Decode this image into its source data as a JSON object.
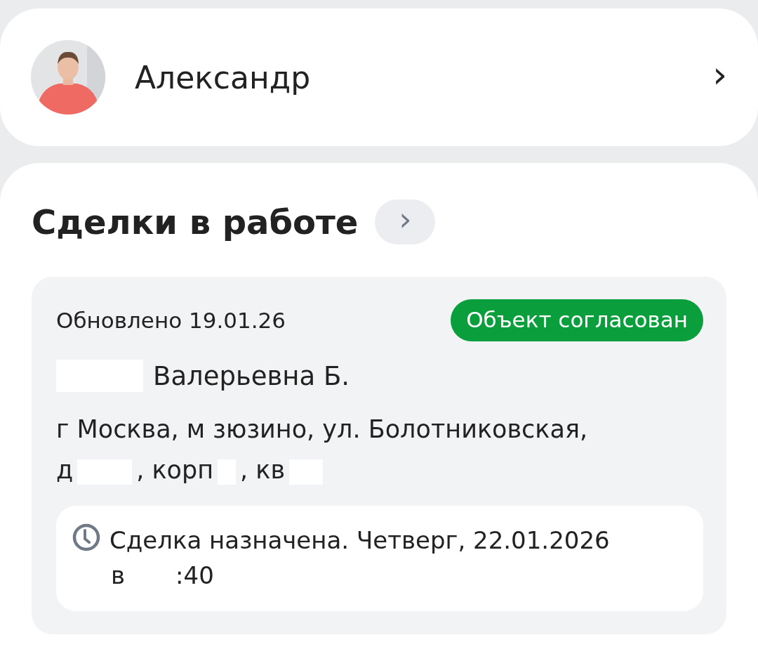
{
  "profile": {
    "name": "Александр",
    "chevron": "›"
  },
  "deals": {
    "title": "Сделки в работе",
    "more": "›",
    "items": [
      {
        "updated": "Обновлено 19.01.26",
        "status": "Объект согласован",
        "color": "#0a9e3c",
        "client": "Валерьевна Б.",
        "address_line": "г Москва, м зюзино, ул. Болотниковская,",
        "address_parts": [
          "д",
          ", корп",
          ", кв"
        ],
        "schedule": {
          "text": "Сделка назначена. Четверг, 22.01.2026",
          "time_prefix": "в",
          "time": ":40"
        }
      }
    ]
  }
}
